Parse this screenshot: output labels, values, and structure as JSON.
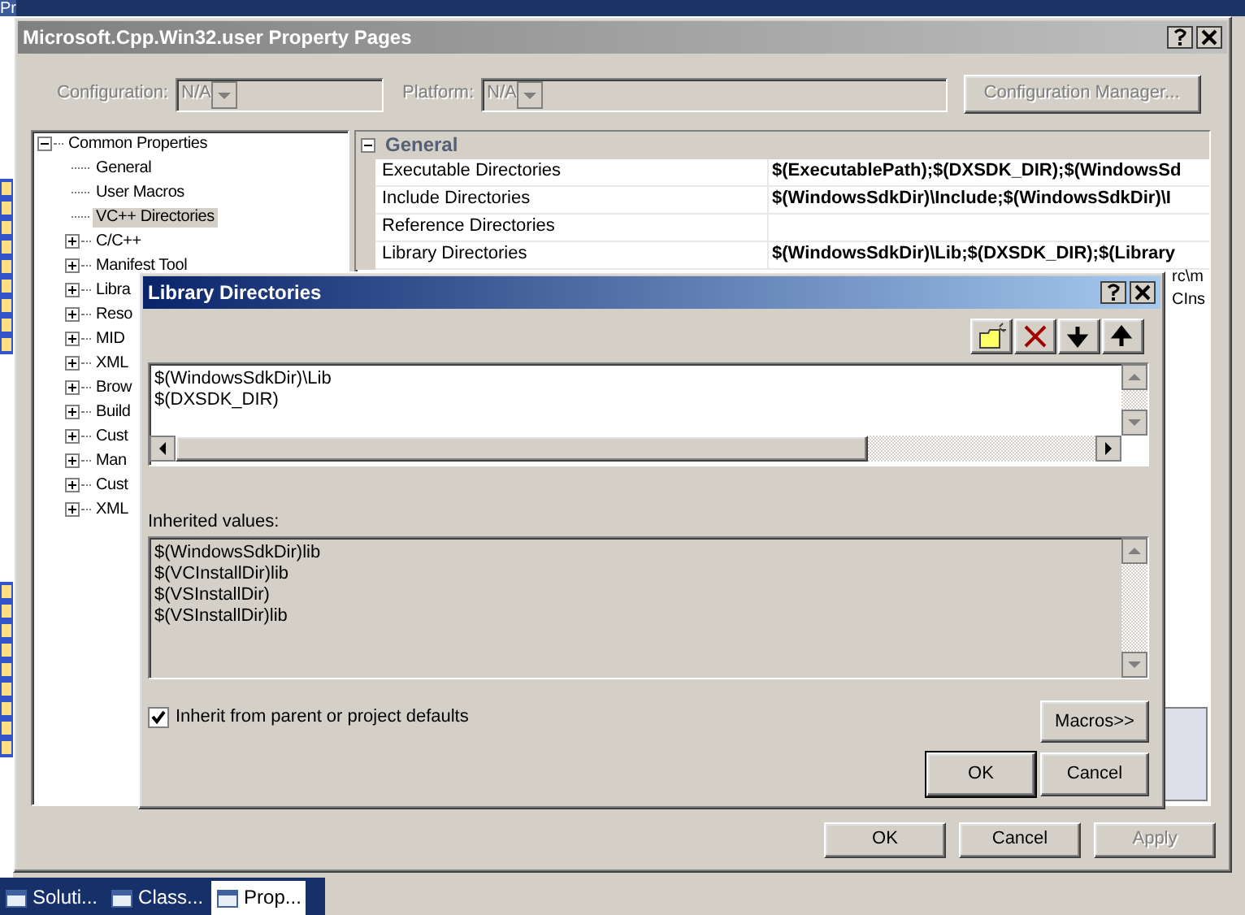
{
  "background_fragment": "Pr",
  "window": {
    "title": "Microsoft.Cpp.Win32.user Property Pages",
    "active": false
  },
  "config_bar": {
    "disabled": true,
    "configuration_label": "Configuration:",
    "configuration_value": "N/A",
    "platform_label": "Platform:",
    "platform_value": "N/A",
    "manager_button": "Configuration Manager..."
  },
  "tree": [
    {
      "label": "Common Properties",
      "selected": false,
      "expanded": true,
      "children": [
        {
          "label": "General",
          "selected": false
        },
        {
          "label": "User Macros",
          "selected": false
        },
        {
          "label": "VC++ Directories",
          "selected": true
        },
        {
          "label": "C/C++",
          "selected": false,
          "expanded": false
        },
        {
          "label": "Manifest Tool",
          "selected": false,
          "expanded": false
        },
        {
          "label": "Libra",
          "selected": false,
          "expanded": false
        },
        {
          "label": "Reso",
          "selected": false,
          "expanded": false
        },
        {
          "label": "MID",
          "selected": false,
          "expanded": false
        },
        {
          "label": "XML",
          "selected": false,
          "expanded": false
        },
        {
          "label": "Brow",
          "selected": false,
          "expanded": false
        },
        {
          "label": "Build",
          "selected": false,
          "expanded": false
        },
        {
          "label": "Cust",
          "selected": false,
          "expanded": false
        },
        {
          "label": "Man",
          "selected": false,
          "expanded": false
        },
        {
          "label": "Cust",
          "selected": false,
          "expanded": false
        },
        {
          "label": "XML",
          "selected": false,
          "expanded": false
        }
      ]
    }
  ],
  "grid": {
    "category": "General",
    "expanded": true,
    "rows": [
      {
        "name": "Executable Directories",
        "value": "$(ExecutablePath);$(DXSDK_DIR);$(WindowsSd"
      },
      {
        "name": "Include Directories",
        "value": "$(WindowsSdkDir)\\Include;$(WindowsSdkDir)\\I"
      },
      {
        "name": "Reference Directories"
      },
      {
        "name": "Library Directories",
        "value": "$(WindowsSdkDir)\\Lib;$(DXSDK_DIR);$(Library"
      }
    ],
    "clipped_values": [
      "rc\\m",
      "CIns"
    ]
  },
  "buttons": [
    {
      "label": "OK",
      "disabled": false
    },
    {
      "label": "Cancel",
      "disabled": false
    },
    {
      "label": "Apply",
      "disabled": true
    }
  ],
  "dialog": {
    "title": "Library Directories",
    "toolbar": [
      {
        "kind": "new-folder"
      },
      {
        "kind": "delete"
      },
      {
        "kind": "down"
      },
      {
        "kind": "up"
      }
    ],
    "entries": [
      "$(WindowsSdkDir)\\Lib",
      "$(DXSDK_DIR)"
    ],
    "inherited_label": "Inherited values:",
    "inherited": [
      "$(WindowsSdkDir)lib",
      "$(VCInstallDir)lib",
      "$(VSInstallDir)",
      "$(VSInstallDir)lib"
    ],
    "inherit_checkbox": {
      "label": "Inherit from parent or project defaults",
      "checked": true
    },
    "macros_button": "Macros>>",
    "buttons": [
      {
        "label": "OK",
        "default": true
      },
      {
        "label": "Cancel",
        "default": false
      }
    ]
  },
  "taskbar": [
    {
      "label": "Soluti...",
      "selected": false
    },
    {
      "label": "Class...",
      "selected": false
    },
    {
      "label": "Prop...",
      "selected": true
    }
  ]
}
